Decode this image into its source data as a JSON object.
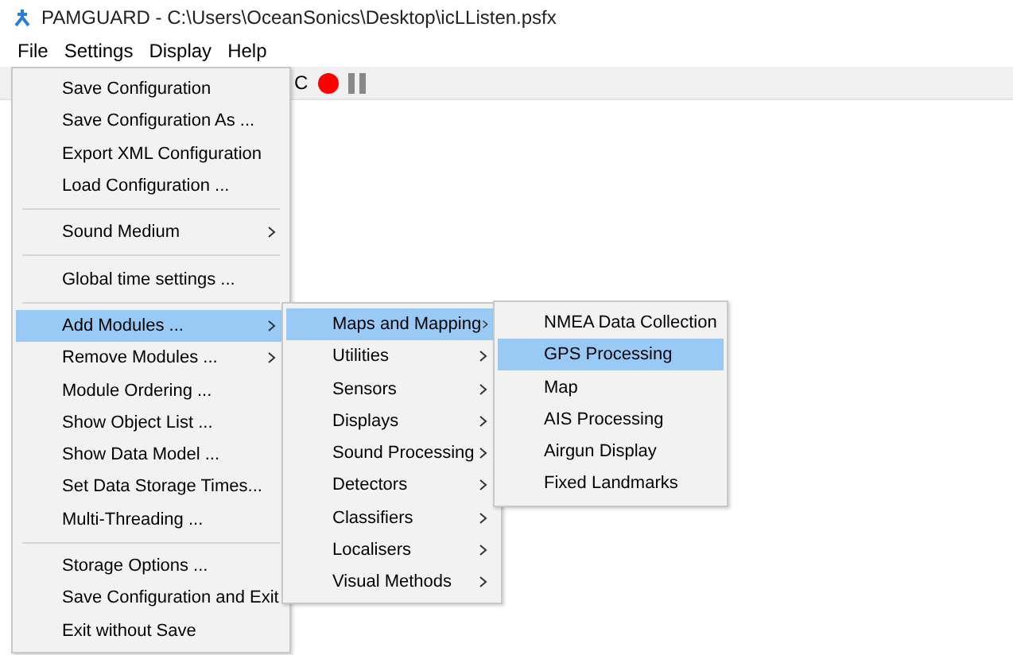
{
  "window": {
    "title": "PAMGUARD - C:\\Users\\OceanSonics\\Desktop\\icLListen.psfx"
  },
  "menubar": [
    {
      "label": "File",
      "selected": false
    },
    {
      "label": "Settings",
      "selected": false
    },
    {
      "label": "Display",
      "selected": false
    },
    {
      "label": "Help",
      "selected": false
    }
  ],
  "toolbar": {
    "text": "C"
  },
  "settings_menu": {
    "items": [
      {
        "kind": "item",
        "label": "Save Configuration",
        "selected": false
      },
      {
        "kind": "item",
        "label": "Save Configuration As ...",
        "selected": false
      },
      {
        "kind": "item",
        "label": "Export XML Configuration",
        "selected": false
      },
      {
        "kind": "item",
        "label": "Load Configuration ...",
        "selected": false
      },
      {
        "kind": "separator"
      },
      {
        "kind": "submenu",
        "label": "Sound Medium",
        "selected": false
      },
      {
        "kind": "separator"
      },
      {
        "kind": "item",
        "label": "Global time settings ...",
        "selected": false
      },
      {
        "kind": "separator"
      },
      {
        "kind": "submenu",
        "label": "Add Modules ...",
        "selected": true,
        "children": [
          {
            "kind": "submenu",
            "label": "Maps and Mapping",
            "selected": true,
            "children": [
              {
                "kind": "item",
                "label": "NMEA Data Collection",
                "selected": false
              },
              {
                "kind": "item",
                "label": "GPS Processing",
                "selected": true
              },
              {
                "kind": "item",
                "label": "Map",
                "selected": false
              },
              {
                "kind": "item",
                "label": "AIS Processing",
                "selected": false
              },
              {
                "kind": "item",
                "label": "Airgun Display",
                "selected": false
              },
              {
                "kind": "item",
                "label": "Fixed Landmarks",
                "selected": false
              }
            ]
          },
          {
            "kind": "submenu",
            "label": "Utilities",
            "selected": false
          },
          {
            "kind": "submenu",
            "label": "Sensors",
            "selected": false
          },
          {
            "kind": "submenu",
            "label": "Displays",
            "selected": false
          },
          {
            "kind": "submenu",
            "label": "Sound Processing",
            "selected": false
          },
          {
            "kind": "submenu",
            "label": "Detectors",
            "selected": false
          },
          {
            "kind": "submenu",
            "label": "Classifiers",
            "selected": false
          },
          {
            "kind": "submenu",
            "label": "Localisers",
            "selected": false
          },
          {
            "kind": "submenu",
            "label": "Visual Methods",
            "selected": false
          }
        ]
      },
      {
        "kind": "submenu",
        "label": "Remove Modules ...",
        "selected": false
      },
      {
        "kind": "item",
        "label": "Module Ordering ...",
        "selected": false
      },
      {
        "kind": "item",
        "label": "Show Object List ...",
        "selected": false
      },
      {
        "kind": "item",
        "label": "Show Data Model ...",
        "selected": false
      },
      {
        "kind": "item",
        "label": "Set Data Storage Times...",
        "selected": false
      },
      {
        "kind": "item",
        "label": "Multi-Threading ...",
        "selected": false
      },
      {
        "kind": "separator"
      },
      {
        "kind": "item",
        "label": "Storage Options ...",
        "selected": false
      },
      {
        "kind": "item",
        "label": "Save Configuration and Exit",
        "selected": false
      },
      {
        "kind": "item",
        "label": "Exit without Save",
        "selected": false
      }
    ]
  }
}
